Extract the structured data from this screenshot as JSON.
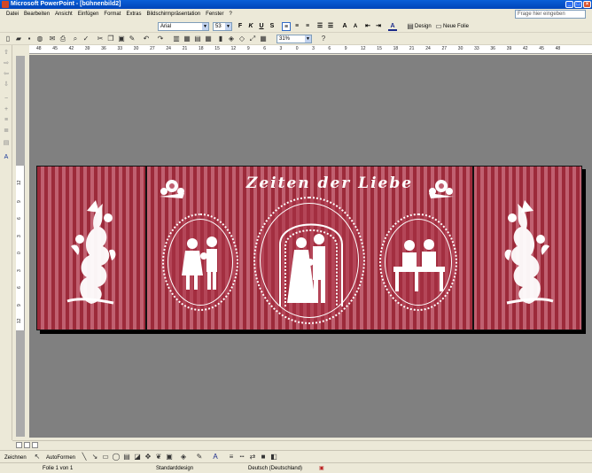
{
  "window": {
    "title": "Microsoft PowerPoint - [bühnenbild2]",
    "minimize": "_",
    "maximize": "□",
    "close": "×"
  },
  "menu": {
    "items": [
      "Datei",
      "Bearbeiten",
      "Ansicht",
      "Einfügen",
      "Format",
      "Extras",
      "Bildschirmpräsentation",
      "Fenster",
      "?"
    ],
    "help_placeholder": "Frage hier eingeben"
  },
  "formatting": {
    "font": "Arial",
    "size": "53",
    "bold": "F",
    "italic": "K",
    "underline": "U",
    "shadow": "S",
    "design_label": "Design",
    "new_slide_label": "Neue Folie"
  },
  "standard": {
    "zoom": "31%"
  },
  "ruler": {
    "h_ticks": [
      "48",
      "45",
      "42",
      "39",
      "36",
      "33",
      "30",
      "27",
      "24",
      "21",
      "18",
      "15",
      "12",
      "9",
      "6",
      "3",
      "0",
      "3",
      "6",
      "9",
      "12",
      "15",
      "18",
      "21",
      "24",
      "27",
      "30",
      "33",
      "36",
      "39",
      "42",
      "45",
      "48"
    ],
    "v_ticks": [
      "12",
      "9",
      "6",
      "3",
      "0",
      "3",
      "6",
      "9",
      "12"
    ]
  },
  "slide": {
    "title": "Zeiten der Liebe"
  },
  "drawing": {
    "draw_label": "Zeichnen",
    "autoshapes_label": "AutoFormen"
  },
  "status": {
    "slide_info": "Folie 1 von 1",
    "design": "Standarddesign",
    "language": "Deutsch (Deutschland)"
  },
  "colors": {
    "stripe_dark": "#9c2a3a",
    "stripe_light": "#c06070",
    "canvas": "#808080",
    "chrome": "#ece9d8"
  }
}
